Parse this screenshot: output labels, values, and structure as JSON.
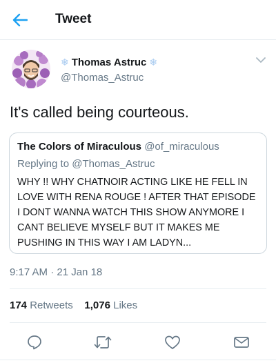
{
  "header": {
    "title": "Tweet",
    "back_icon": "arrow-left-icon",
    "accent": "#1da1f2"
  },
  "author": {
    "name": "Thomas Astruc",
    "handle": "@Thomas_Astruc",
    "decoration": "snowflake-icon"
  },
  "tweet": {
    "text": "It's called being courteous."
  },
  "quoted": {
    "name": "The Colors of Miraculous",
    "handle": "@of_miraculous",
    "reply_prefix": "Replying to",
    "reply_target": "@Thomas_Astruc",
    "text": "WHY !! WHY CHATNOIR ACTING LIKE HE FELL IN LOVE WITH RENA ROUGE ! AFTER THAT EPISODE I DONT WANNA WATCH THIS SHOW ANYMORE I CANT BELIEVE MYSELF BUT IT MAKES ME PUSHING IN THIS WAY I AM LADYN..."
  },
  "timestamp": "9:17 AM · 21 Jan 18",
  "stats": {
    "retweets_count": "174",
    "retweets_label": "Retweets",
    "likes_count": "1,076",
    "likes_label": "Likes"
  },
  "actions": [
    "reply-icon",
    "retweet-icon",
    "like-icon",
    "share-icon"
  ],
  "colors": {
    "text": "#14171a",
    "muted": "#657786",
    "border": "#e6ecf0",
    "accent": "#1da1f2"
  }
}
